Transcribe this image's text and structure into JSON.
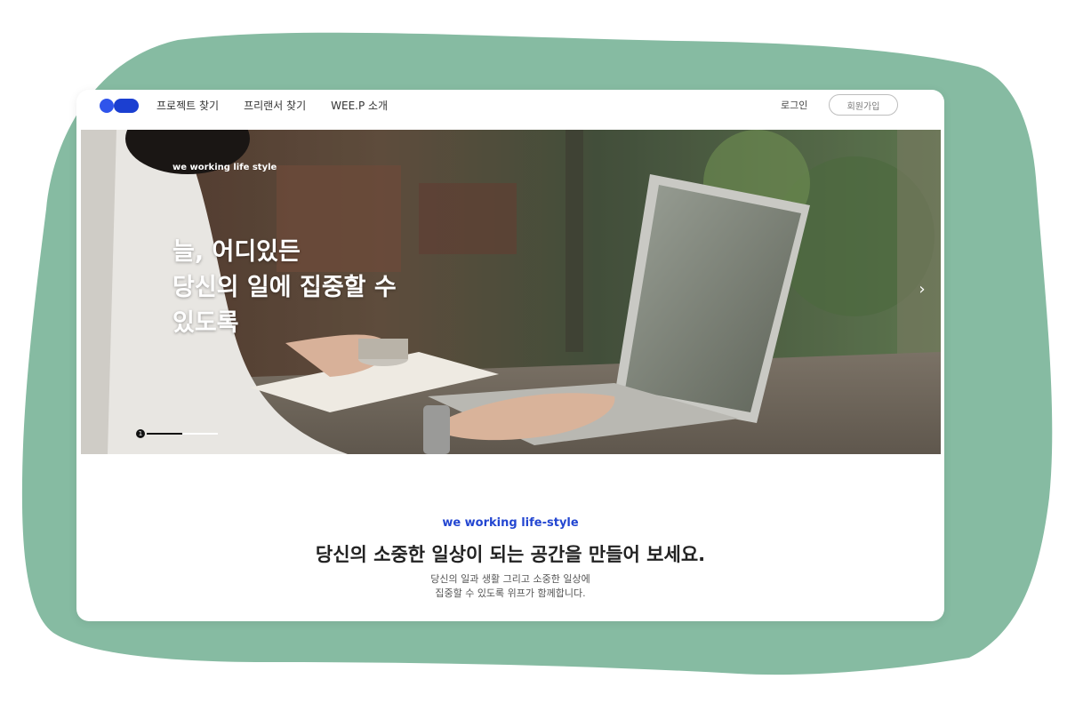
{
  "colors": {
    "background_blob": "#86bba2",
    "brand_blue": "#2f54eb",
    "accent_text": "#2346d1"
  },
  "nav": {
    "logo_icon": "three-dot-logo",
    "menu": [
      "프로젝트 찾기",
      "프리랜서 찾기",
      "WEE.P 소개"
    ],
    "login_label": "로그인",
    "signup_label": "회원가입"
  },
  "hero": {
    "tagline": "we working life style",
    "headline": [
      "늘, 어디있든",
      "당신의 일에 집중할 수",
      "있도록"
    ],
    "next_icon": "chevron-right-icon",
    "slide_number": "1"
  },
  "intro": {
    "tagline": "we working life-style",
    "title": "당신의 소중한 일상이 되는 공간을 만들어 보세요.",
    "description": [
      "당신의 일과 생활 그리고 소중한 일상에",
      "집중할 수 있도록 위프가 함께합니다."
    ]
  }
}
